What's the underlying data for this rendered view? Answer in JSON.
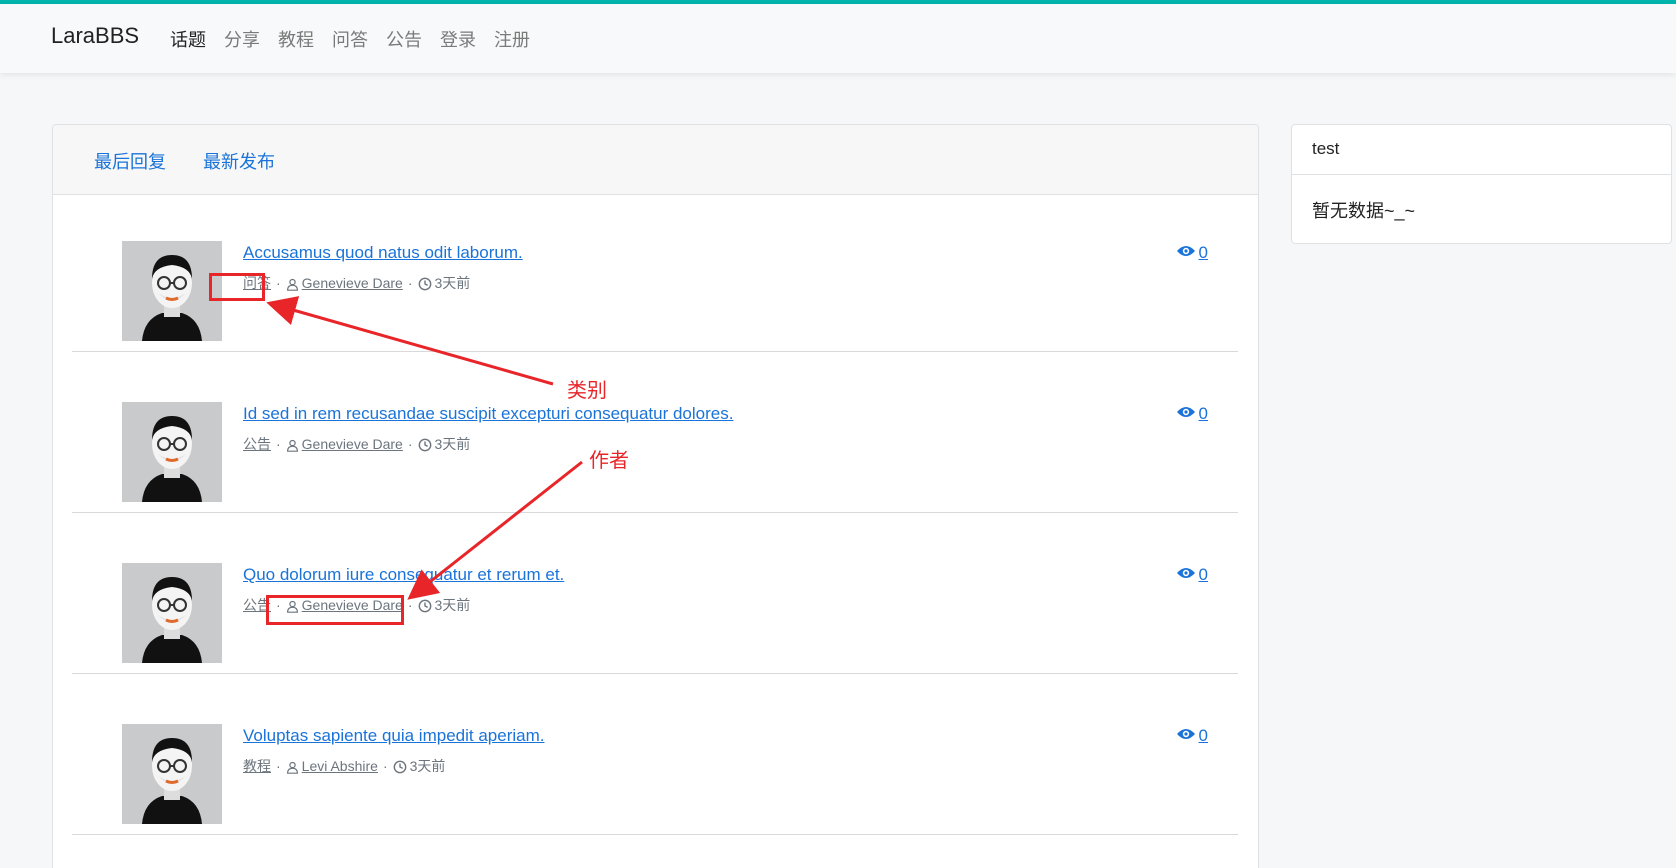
{
  "navbar": {
    "brand": "LaraBBS",
    "items": [
      {
        "label": "话题",
        "active": true
      },
      {
        "label": "分享"
      },
      {
        "label": "教程"
      },
      {
        "label": "问答"
      },
      {
        "label": "公告"
      },
      {
        "label": "登录"
      },
      {
        "label": "注册"
      }
    ]
  },
  "tabs": [
    "最后回复",
    "最新发布"
  ],
  "topics": [
    {
      "title": "Accusamus quod natus odit laborum.",
      "category": "问答",
      "author": "Genevieve Dare",
      "time": "3天前",
      "views": "0"
    },
    {
      "title": "Id sed in rem recusandae suscipit excepturi consequatur dolores.",
      "category": "公告",
      "author": "Genevieve Dare",
      "time": "3天前",
      "views": "0"
    },
    {
      "title": "Quo dolorum iure consequatur et rerum et.",
      "category": "公告",
      "author": "Genevieve Dare",
      "time": "3天前",
      "views": "0"
    },
    {
      "title": "Voluptas sapiente quia impedit aperiam.",
      "category": "教程",
      "author": "Levi Abshire",
      "time": "3天前",
      "views": "0"
    }
  ],
  "sidebar": {
    "title": "test",
    "body": "暂无数据~_~"
  },
  "annotations": {
    "category_label": "类别",
    "author_label": "作者"
  },
  "colors": {
    "accent": "#00b5ad",
    "link": "#1a73d9",
    "annotation": "#e8262a"
  }
}
